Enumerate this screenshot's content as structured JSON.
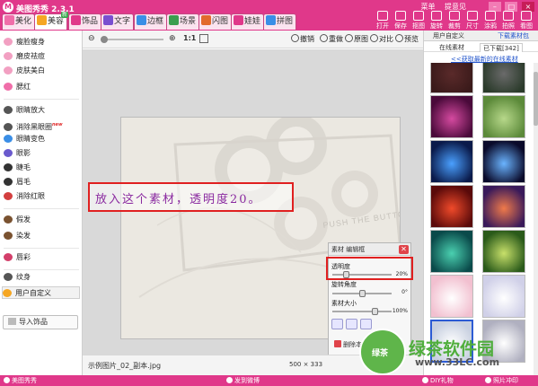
{
  "app": {
    "title": "美图秀秀 2.3.1"
  },
  "top_links": [
    "菜单",
    "提意见"
  ],
  "tabs": [
    {
      "label": "美化",
      "color": "#f06ea9"
    },
    {
      "label": "美容",
      "color": "#f5a623",
      "badge": "新"
    },
    {
      "label": "饰品",
      "color": "#e0388a"
    },
    {
      "label": "文字",
      "color": "#7a4fd0"
    },
    {
      "label": "边框",
      "color": "#3a8ee6"
    },
    {
      "label": "场景",
      "color": "#3b9e4e"
    },
    {
      "label": "闪图",
      "color": "#e26a2c"
    },
    {
      "label": "娃娃",
      "color": "#e0388a"
    },
    {
      "label": "拼图",
      "color": "#3a8ee6"
    }
  ],
  "actions": [
    "打开",
    "保存",
    "抠图",
    "旋转",
    "裁剪",
    "尺寸",
    "涂鸦",
    "拍照",
    "看图"
  ],
  "sidebar": {
    "items": [
      {
        "label": "瘦脸瘦身",
        "color": "#f2a0c2"
      },
      {
        "label": "磨皮祛痘",
        "color": "#f2a0c2"
      },
      {
        "label": "皮肤美白",
        "color": "#f2a0c2"
      },
      {
        "label": "腮红",
        "color": "#f06ea9"
      },
      {
        "label": "眼睛放大",
        "color": "#555555"
      },
      {
        "label": "消除黑眼圈",
        "color": "#555555",
        "tag": "new"
      },
      {
        "label": "眼睛变色",
        "color": "#3a8ee6"
      },
      {
        "label": "眼影",
        "color": "#6a5acd"
      },
      {
        "label": "睫毛",
        "color": "#333333"
      },
      {
        "label": "眉毛",
        "color": "#333333"
      },
      {
        "label": "消除红眼",
        "color": "#d33f3f"
      },
      {
        "label": "假发",
        "color": "#7a5230"
      },
      {
        "label": "染发",
        "color": "#7a5230"
      },
      {
        "label": "唇彩",
        "color": "#d33f6a"
      },
      {
        "label": "纹身",
        "color": "#555555"
      },
      {
        "label": "用户自定义",
        "color": "#f5a623"
      }
    ],
    "import_label": "导入饰品"
  },
  "toolbar": {
    "ratio": "1:1",
    "buttons": [
      "撤销",
      "重做",
      "原图",
      "对比",
      "预览"
    ]
  },
  "canvas": {
    "annotation": "放入这个素材，透明度20。",
    "photo_text": "PUSH THE BUTTON TO"
  },
  "status": {
    "file_name": "示例图片_02_副本.jpg",
    "dims": "500 × 333"
  },
  "material_panel": {
    "title": "素材 编辑框",
    "close": "✕",
    "opacity_label": "透明度",
    "opacity_value": "20%",
    "opacity": 0.2,
    "rotate_label": "旋转角度",
    "rotate_value": "0°",
    "rotate": 0,
    "size_label": "素材大小",
    "size_value": "100%",
    "size": 1.0,
    "delete_label": "删除本素材"
  },
  "right_panel": {
    "tab_left": "用户自定义",
    "tab_right": "下载素材包",
    "subtabs": [
      "在线素材",
      "已下载[342]"
    ],
    "link": "<<获取最新的在线素材",
    "thumbs": [
      {
        "c1": "#3a1a1a",
        "c2": "#5a2a2a"
      },
      {
        "c1": "#2a3a2a",
        "c2": "#6a6a6a"
      },
      {
        "c1": "#4a0a3a",
        "c2": "#d54aa0"
      },
      {
        "c1": "#5c8a3a",
        "c2": "#b7d88a"
      },
      {
        "c1": "#0a1a4a",
        "c2": "#4aa0ff"
      },
      {
        "c1": "#0a0a2a",
        "c2": "#6ab4ff"
      },
      {
        "c1": "#5a0a0a",
        "c2": "#f04a2a"
      },
      {
        "c1": "#3a1a5a",
        "c2": "#f07a4a"
      },
      {
        "c1": "#0a4a4a",
        "c2": "#4ad0b0"
      },
      {
        "c1": "#2a5a1a",
        "c2": "#c8e06a"
      },
      {
        "c1": "#f2c0d0",
        "c2": "#ffffff"
      },
      {
        "c1": "#d0d0e8",
        "c2": "#ffffff"
      },
      {
        "c1": "#c8d0e0",
        "c2": "#ffffff"
      },
      {
        "c1": "#b0b0c0",
        "c2": "#ffffff"
      }
    ]
  },
  "bottom_bar": [
    "美图秀秀",
    "发到微博",
    "DIY礼物",
    "照片冲印"
  ],
  "watermark": {
    "site": "绿茶软件园",
    "badge": "绿茶",
    "url": "www.33LC.com"
  }
}
